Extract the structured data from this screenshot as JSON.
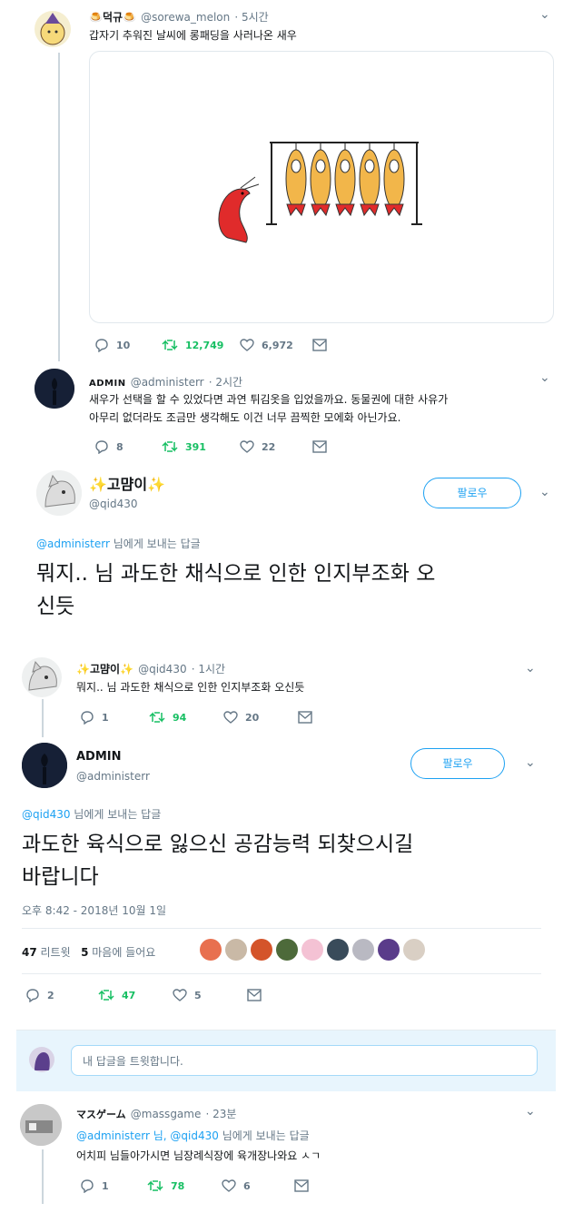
{
  "tweet1": {
    "name": "🍮덕규🍮",
    "handle": "@sorewa_melon",
    "time": "· 5시간",
    "text": "갑자기 추워진 날씨에 롱패딩을 사러나온 새우",
    "replies": "10",
    "retweets": "12,749",
    "likes": "6,972"
  },
  "tweet2": {
    "name": "ADMIN",
    "handle": "@administerr",
    "time": "· 2시간",
    "text_line1": "새우가 선택을 할 수 있었다면 과연 튀김옷을 입었을까요. 동물권에 대한 사유가",
    "text_line2": "아무리 없더라도 조금만 생각해도 이건 너무 끔찍한 모에화 아닌가요.",
    "replies": "8",
    "retweets": "391",
    "likes": "22"
  },
  "focus1": {
    "name": "✨고먐이✨",
    "handle": "@qid430",
    "follow_label": "팔로우",
    "reply_to_handle": "@administerr",
    "reply_to_suffix": " 님에게 보내는 답글",
    "text_line1": "뭐지.. 님 과도한 채식으로 인한 인지부조화 오",
    "text_line2": "신듯"
  },
  "tweet3": {
    "name": "✨고먐이✨",
    "handle": "@qid430",
    "time": "· 1시간",
    "text": "뭐지.. 님 과도한 채식으로 인한 인지부조화 오신듯",
    "replies": "1",
    "retweets": "94",
    "likes": "20"
  },
  "focus2": {
    "name": "ADMIN",
    "handle": "@administerr",
    "follow_label": "팔로우",
    "reply_to_handle": "@qid430",
    "reply_to_suffix": " 님에게 보내는 답글",
    "text_line1": "과도한 육식으로 잃으신 공감능력 되찾으시길",
    "text_line2": "바랍니다",
    "timestamp": "오후 8:42 - 2018년 10월 1일",
    "retweet_count": "47",
    "retweet_label": " 리트윗",
    "like_count": "5",
    "like_label": " 마음에 들어요",
    "replies": "2",
    "retweets": "47",
    "likes": "5"
  },
  "compose": {
    "placeholder": "내 답글을 트윗합니다."
  },
  "tweet4": {
    "name": "マスゲーム",
    "handle": "@massgame",
    "time": "· 23분",
    "reply_to_handles": "@administerr 님, @qid430",
    "reply_to_suffix": " 님에게 보내는 답글",
    "text": "어치피 님들아가시면 님장례식장에 육개장나와요 ㅅㄱ",
    "replies": "1",
    "retweets": "78",
    "likes": "6"
  },
  "colors": {
    "accent": "#1da1f2",
    "retweet_green": "#17bf63",
    "muted": "#657786"
  }
}
